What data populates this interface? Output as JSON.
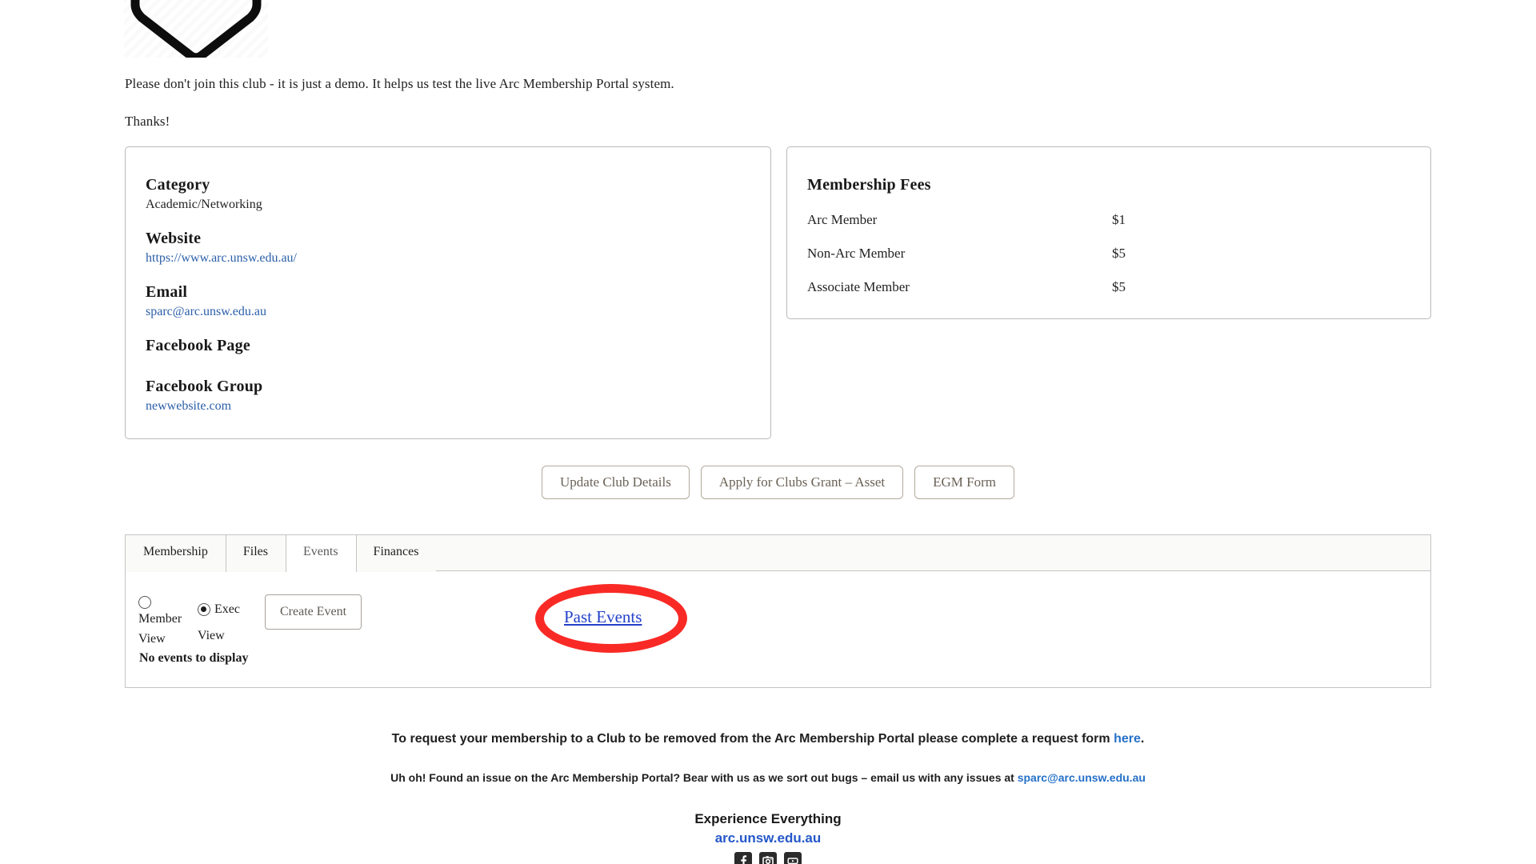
{
  "logo": {
    "icon": "shield-badge-logo"
  },
  "intro": {
    "line1": "Please don't join this club - it is just a demo. It helps us test the live Arc Membership Portal system.",
    "line2": "Thanks!"
  },
  "details_card": {
    "fields": [
      {
        "label": "Category",
        "value": "Academic/Networking",
        "is_link": false
      },
      {
        "label": "Website",
        "value": "https://www.arc.unsw.edu.au/",
        "is_link": true
      },
      {
        "label": "Email",
        "value": "sparc@arc.unsw.edu.au",
        "is_link": true
      },
      {
        "label": "Facebook Page",
        "value": "",
        "is_link": false
      },
      {
        "label": "Facebook Group",
        "value": "newwebsite.com",
        "is_link": true
      }
    ]
  },
  "fees_card": {
    "title": "Membership Fees",
    "rows": [
      {
        "name": "Arc Member",
        "price": "$1"
      },
      {
        "name": "Non-Arc Member",
        "price": "$5"
      },
      {
        "name": "Associate Member",
        "price": "$5"
      }
    ]
  },
  "actions": {
    "update_club_details": "Update Club Details",
    "apply_clubs_grant": "Apply for Clubs Grant – Asset",
    "egm_form": "EGM Form"
  },
  "tabs": {
    "items": [
      {
        "label": "Membership",
        "active": false
      },
      {
        "label": "Files",
        "active": false
      },
      {
        "label": "Events",
        "active": true
      },
      {
        "label": "Finances",
        "active": false
      }
    ]
  },
  "events_panel": {
    "radio_member_line1": "Member",
    "radio_member_line2": "View",
    "radio_exec_line1": "Exec",
    "radio_exec_line2": "View",
    "selected_view": "Exec View",
    "create_event_label": "Create Event",
    "past_events_label": "Past Events",
    "empty_message": "No events to display"
  },
  "annotation": {
    "shape": "oval-highlight",
    "color": "#f92a25",
    "target": "Past Events"
  },
  "footer": {
    "removal_text_before": "To request your membership to a Club to be removed from the Arc Membership Portal please complete a request form ",
    "removal_link": "here",
    "removal_text_after": ".",
    "issue_text_before": "Uh oh! Found an issue on the Arc Membership Portal? Bear with us as we sort out bugs – email us with any issues at ",
    "issue_email": "sparc@arc.unsw.edu.au",
    "tagline": "Experience Everything",
    "site": "arc.unsw.edu.au",
    "social": [
      {
        "name": "facebook-icon"
      },
      {
        "name": "instagram-icon"
      },
      {
        "name": "youtube-icon"
      }
    ]
  },
  "colors": {
    "link_blue": "#2b5fa8",
    "footer_blue": "#2570c8",
    "annotation_red": "#f92a25",
    "button_text": "#6b6257"
  }
}
